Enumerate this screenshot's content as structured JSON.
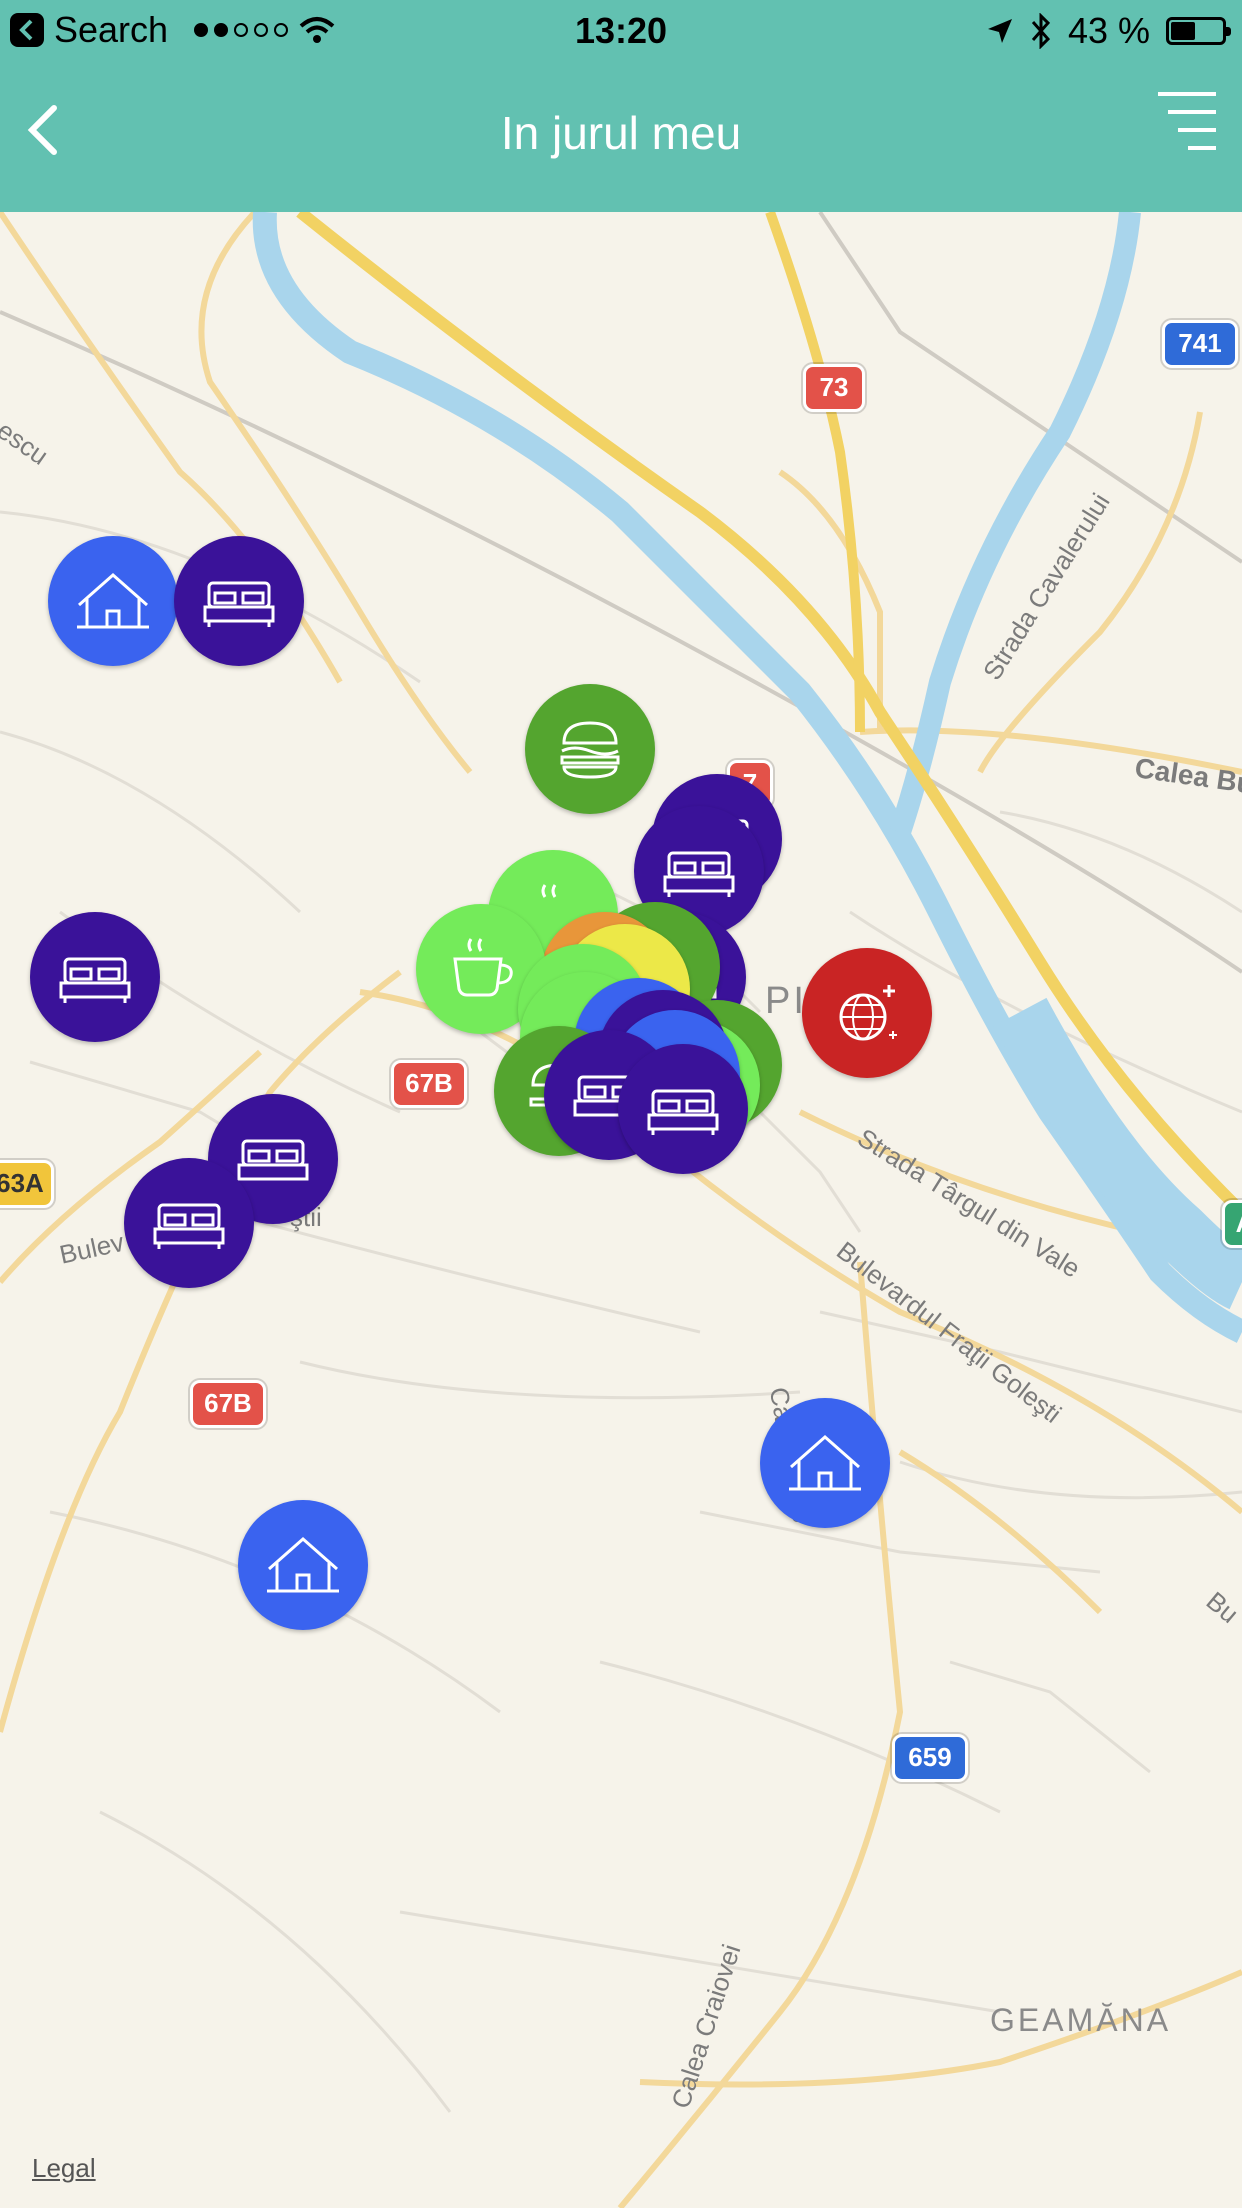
{
  "status_bar": {
    "carrier": "Search",
    "time": "13:20",
    "battery": "43 %"
  },
  "header": {
    "title": "In jurul meu"
  },
  "map": {
    "city_label": "PITEŞTI",
    "labels": {
      "strada_cavalerului": "Strada Cavalerului",
      "calea_bu": "Calea Bu",
      "strada_targul": "Strada Târgul din Vale",
      "bulevardul": "Bulevardul Fraţii Goleşti",
      "calea_craio": "Calea Craio",
      "calea_craiovei": "Calea Craiovei",
      "geamana": "GEAMĂNA",
      "escu": "escu",
      "bulev": "Bulev",
      "stii": "ştii",
      "bu_right": "Bu"
    },
    "road_shields": {
      "r73": "73",
      "r741": "741",
      "r7": "7",
      "r67b_a": "67B",
      "r67b_b": "67B",
      "r659": "659",
      "r63a": "63A",
      "rA": "A"
    },
    "legal": "Legal"
  },
  "pins": [
    {
      "category": "house",
      "color": "#3a63ef"
    },
    {
      "category": "bed",
      "color": "#3a1299"
    },
    {
      "category": "burger",
      "color": "#54a52f"
    },
    {
      "category": "coffee",
      "color": "#74eb5a"
    },
    {
      "category": "disco",
      "color": "#c92424"
    },
    {
      "category": "house",
      "color": "#3a63ef"
    }
  ]
}
